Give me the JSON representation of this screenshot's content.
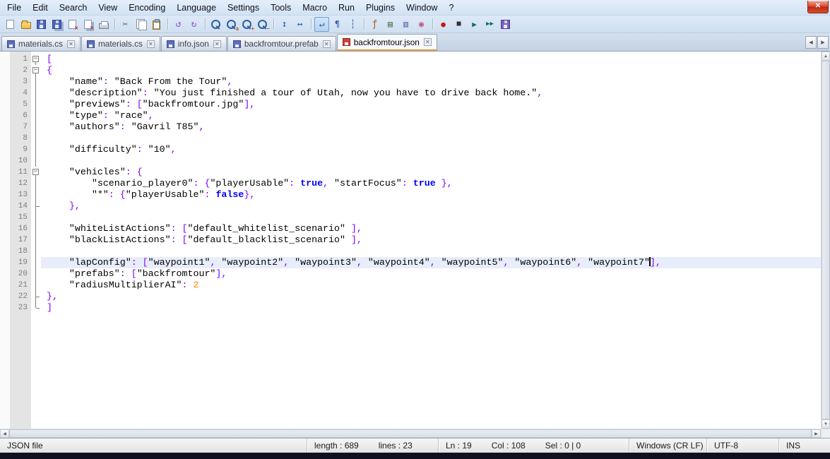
{
  "window": {
    "close_glyph": "✕"
  },
  "menubar": {
    "items": [
      {
        "label": "File"
      },
      {
        "label": "Edit"
      },
      {
        "label": "Search"
      },
      {
        "label": "View"
      },
      {
        "label": "Encoding"
      },
      {
        "label": "Language"
      },
      {
        "label": "Settings"
      },
      {
        "label": "Tools"
      },
      {
        "label": "Macro"
      },
      {
        "label": "Run"
      },
      {
        "label": "Plugins"
      },
      {
        "label": "Window"
      },
      {
        "label": "?"
      }
    ]
  },
  "toolbar": {
    "items": [
      {
        "name": "new-file",
        "kind": "css",
        "cls": "ic-page"
      },
      {
        "name": "open-file",
        "kind": "css",
        "cls": "ic-folder"
      },
      {
        "name": "save-file",
        "kind": "css",
        "cls": "ic-floppy"
      },
      {
        "name": "save-all",
        "kind": "css",
        "cls": "ic-floppy ic-multi"
      },
      {
        "name": "close-file",
        "kind": "css",
        "cls": "ic-page ic-close"
      },
      {
        "name": "close-all-files",
        "kind": "css",
        "cls": "ic-page ic-close ic-multi"
      },
      {
        "name": "print",
        "kind": "css",
        "cls": "ic-printer"
      },
      {
        "sep": true
      },
      {
        "name": "cut",
        "kind": "glyph",
        "glyph": "✂",
        "color": "#555555",
        "size": 12
      },
      {
        "name": "copy",
        "kind": "css",
        "cls": "ic-copy"
      },
      {
        "name": "paste",
        "kind": "css",
        "cls": "ic-paste"
      },
      {
        "sep": true
      },
      {
        "name": "undo",
        "kind": "glyph",
        "glyph": "↺",
        "color": "#8a4fd1",
        "size": 13
      },
      {
        "name": "redo",
        "kind": "glyph",
        "glyph": "↻",
        "color": "#8a4fd1",
        "size": 13
      },
      {
        "sep": true
      },
      {
        "name": "find",
        "kind": "css",
        "cls": "ic-mag"
      },
      {
        "name": "replace",
        "kind": "css",
        "cls": "ic-mag",
        "sub": "a"
      },
      {
        "name": "zoom-in",
        "kind": "css",
        "cls": "ic-mag",
        "sub": "+"
      },
      {
        "name": "zoom-out",
        "kind": "css",
        "cls": "ic-mag",
        "sub": "−"
      },
      {
        "sep": true
      },
      {
        "name": "sync-vertical-scrolling",
        "kind": "glyph",
        "glyph": "↕",
        "color": "#2f5fa8",
        "size": 13
      },
      {
        "name": "sync-horizontal-scrolling",
        "kind": "glyph",
        "glyph": "↔",
        "color": "#2f5fa8",
        "size": 13
      },
      {
        "sep": true
      },
      {
        "name": "word-wrap",
        "kind": "glyph",
        "glyph": "↵",
        "color": "#2f5fa8",
        "size": 13,
        "pressed": true
      },
      {
        "name": "show-all-characters",
        "kind": "glyph",
        "glyph": "¶",
        "color": "#2f5fa8",
        "size": 12
      },
      {
        "name": "show-indent-guide",
        "kind": "glyph",
        "glyph": "┆",
        "color": "#2f5fa8",
        "size": 12
      },
      {
        "sep": true
      },
      {
        "name": "function-list",
        "kind": "glyph",
        "glyph": "ƒ",
        "color": "#b05c10",
        "size": 13
      },
      {
        "name": "document-map",
        "kind": "glyph",
        "glyph": "▤",
        "color": "#4f7a4f",
        "size": 12
      },
      {
        "name": "document-list",
        "kind": "glyph",
        "glyph": "▥",
        "color": "#6a5fae",
        "size": 12
      },
      {
        "name": "monitoring",
        "kind": "glyph",
        "glyph": "◉",
        "color": "#c2527a",
        "size": 12
      },
      {
        "sep": true
      },
      {
        "name": "macro-record",
        "kind": "glyph",
        "glyph": "●",
        "color": "#cc1414",
        "size": 11
      },
      {
        "name": "macro-stop",
        "kind": "glyph",
        "glyph": "■",
        "color": "#333333",
        "size": 10
      },
      {
        "name": "macro-play",
        "kind": "glyph",
        "glyph": "▶",
        "color": "#156868",
        "size": 11
      },
      {
        "name": "macro-run-multiple",
        "kind": "glyph",
        "glyph": "▶▶",
        "color": "#156868",
        "size": 9
      },
      {
        "name": "macro-save",
        "kind": "css",
        "cls": "ic-floppy ic-purple"
      }
    ]
  },
  "tabbar": {
    "close_glyph": "✕",
    "scroll_left": "◀",
    "scroll_right": "▶",
    "tabs": [
      {
        "label": "materials.cs",
        "state": "saved",
        "active": false
      },
      {
        "label": "materials.cs",
        "state": "saved",
        "active": false
      },
      {
        "label": "info.json",
        "state": "saved",
        "active": false
      },
      {
        "label": "backfromtour.prefab",
        "state": "saved",
        "active": false
      },
      {
        "label": "backfromtour.json",
        "state": "modified",
        "active": true
      }
    ]
  },
  "editor": {
    "fold_collapse_glyph": "−",
    "current_line": 19,
    "lines": [
      {
        "n": 1,
        "fold": "box",
        "tokens": [
          [
            "p",
            "["
          ]
        ]
      },
      {
        "n": 2,
        "fold": "box",
        "tokens": [
          [
            "p",
            "{"
          ]
        ]
      },
      {
        "n": 3,
        "fold": "v",
        "tokens": [
          [
            "w",
            "    "
          ],
          [
            "s",
            "\"name\""
          ],
          [
            "p",
            ":"
          ],
          [
            "w",
            " "
          ],
          [
            "s",
            "\"Back From the Tour\""
          ],
          [
            "p",
            ","
          ]
        ]
      },
      {
        "n": 4,
        "fold": "v",
        "tokens": [
          [
            "w",
            "    "
          ],
          [
            "s",
            "\"description\""
          ],
          [
            "p",
            ":"
          ],
          [
            "w",
            " "
          ],
          [
            "s",
            "\"You just finished a tour of Utah, now you have to drive back home.\""
          ],
          [
            "p",
            ","
          ]
        ]
      },
      {
        "n": 5,
        "fold": "v",
        "tokens": [
          [
            "w",
            "    "
          ],
          [
            "s",
            "\"previews\""
          ],
          [
            "p",
            ":"
          ],
          [
            "w",
            " "
          ],
          [
            "p",
            "["
          ],
          [
            "s",
            "\"backfromtour.jpg\""
          ],
          [
            "p",
            "],"
          ]
        ]
      },
      {
        "n": 6,
        "fold": "v",
        "tokens": [
          [
            "w",
            "    "
          ],
          [
            "s",
            "\"type\""
          ],
          [
            "p",
            ":"
          ],
          [
            "w",
            " "
          ],
          [
            "s",
            "\"race\""
          ],
          [
            "p",
            ","
          ]
        ]
      },
      {
        "n": 7,
        "fold": "v",
        "tokens": [
          [
            "w",
            "    "
          ],
          [
            "s",
            "\"authors\""
          ],
          [
            "p",
            ":"
          ],
          [
            "w",
            " "
          ],
          [
            "s",
            "\"Gavril T85\""
          ],
          [
            "p",
            ","
          ]
        ]
      },
      {
        "n": 8,
        "fold": "v",
        "tokens": []
      },
      {
        "n": 9,
        "fold": "v",
        "tokens": [
          [
            "w",
            "    "
          ],
          [
            "s",
            "\"difficulty\""
          ],
          [
            "p",
            ":"
          ],
          [
            "w",
            " "
          ],
          [
            "s",
            "\"10\""
          ],
          [
            "p",
            ","
          ]
        ]
      },
      {
        "n": 10,
        "fold": "v",
        "tokens": []
      },
      {
        "n": 11,
        "fold": "box",
        "tokens": [
          [
            "w",
            "    "
          ],
          [
            "s",
            "\"vehicles\""
          ],
          [
            "p",
            ":"
          ],
          [
            "w",
            " "
          ],
          [
            "p",
            "{"
          ]
        ]
      },
      {
        "n": 12,
        "fold": "v",
        "tokens": [
          [
            "w",
            "        "
          ],
          [
            "s",
            "\"scenario_player0\""
          ],
          [
            "p",
            ":"
          ],
          [
            "w",
            " "
          ],
          [
            "p",
            "{"
          ],
          [
            "s",
            "\"playerUsable\""
          ],
          [
            "p",
            ":"
          ],
          [
            "w",
            " "
          ],
          [
            "k",
            "true"
          ],
          [
            "p",
            ","
          ],
          [
            "w",
            " "
          ],
          [
            "s",
            "\"startFocus\""
          ],
          [
            "p",
            ":"
          ],
          [
            "w",
            " "
          ],
          [
            "k",
            "true"
          ],
          [
            "w",
            " "
          ],
          [
            "p",
            "},"
          ]
        ]
      },
      {
        "n": 13,
        "fold": "v",
        "tokens": [
          [
            "w",
            "        "
          ],
          [
            "s",
            "\"*\""
          ],
          [
            "p",
            ":"
          ],
          [
            "w",
            " "
          ],
          [
            "p",
            "{"
          ],
          [
            "s",
            "\"playerUsable\""
          ],
          [
            "p",
            ":"
          ],
          [
            "w",
            " "
          ],
          [
            "k",
            "false"
          ],
          [
            "p",
            "},"
          ]
        ]
      },
      {
        "n": 14,
        "fold": "tee",
        "tokens": [
          [
            "w",
            "    "
          ],
          [
            "p",
            "},"
          ]
        ]
      },
      {
        "n": 15,
        "fold": "v",
        "tokens": []
      },
      {
        "n": 16,
        "fold": "v",
        "tokens": [
          [
            "w",
            "    "
          ],
          [
            "s",
            "\"whiteListActions\""
          ],
          [
            "p",
            ":"
          ],
          [
            "w",
            " "
          ],
          [
            "p",
            "["
          ],
          [
            "s",
            "\"default_whitelist_scenario\""
          ],
          [
            "w",
            " "
          ],
          [
            "p",
            "],"
          ]
        ]
      },
      {
        "n": 17,
        "fold": "v",
        "tokens": [
          [
            "w",
            "    "
          ],
          [
            "s",
            "\"blackListActions\""
          ],
          [
            "p",
            ":"
          ],
          [
            "w",
            " "
          ],
          [
            "p",
            "["
          ],
          [
            "s",
            "\"default_blacklist_scenario\""
          ],
          [
            "w",
            " "
          ],
          [
            "p",
            "],"
          ]
        ]
      },
      {
        "n": 18,
        "fold": "v",
        "tokens": []
      },
      {
        "n": 19,
        "fold": "v",
        "current": true,
        "tokens": [
          [
            "w",
            "    "
          ],
          [
            "s",
            "\"lapConfig\""
          ],
          [
            "p",
            ":"
          ],
          [
            "w",
            " "
          ],
          [
            "p",
            "["
          ],
          [
            "s",
            "\"waypoint1\""
          ],
          [
            "p",
            ","
          ],
          [
            "w",
            " "
          ],
          [
            "s",
            "\"waypoint2\""
          ],
          [
            "p",
            ","
          ],
          [
            "w",
            " "
          ],
          [
            "s",
            "\"waypoint3\""
          ],
          [
            "p",
            ","
          ],
          [
            "w",
            " "
          ],
          [
            "s",
            "\"waypoint4\""
          ],
          [
            "p",
            ","
          ],
          [
            "w",
            " "
          ],
          [
            "s",
            "\"waypoint5\""
          ],
          [
            "p",
            ","
          ],
          [
            "w",
            " "
          ],
          [
            "s",
            "\"waypoint6\""
          ],
          [
            "p",
            ","
          ],
          [
            "w",
            " "
          ],
          [
            "s",
            "\"waypoint7\""
          ],
          [
            "c",
            ""
          ],
          [
            "p",
            "],"
          ]
        ]
      },
      {
        "n": 20,
        "fold": "v",
        "tokens": [
          [
            "w",
            "    "
          ],
          [
            "s",
            "\"prefabs\""
          ],
          [
            "p",
            ":"
          ],
          [
            "w",
            " "
          ],
          [
            "p",
            "["
          ],
          [
            "s",
            "\"backfromtour\""
          ],
          [
            "p",
            "],"
          ]
        ]
      },
      {
        "n": 21,
        "fold": "v",
        "tokens": [
          [
            "w",
            "    "
          ],
          [
            "s",
            "\"radiusMultiplierAI\""
          ],
          [
            "p",
            ":"
          ],
          [
            "w",
            " "
          ],
          [
            "n",
            "2"
          ]
        ]
      },
      {
        "n": 22,
        "fold": "tee",
        "tokens": [
          [
            "p",
            "},"
          ]
        ]
      },
      {
        "n": 23,
        "fold": "end",
        "tokens": [
          [
            "p",
            "]"
          ]
        ]
      }
    ]
  },
  "scrollbars": {
    "up_glyph": "▲",
    "down_glyph": "▼",
    "left_glyph": "◀",
    "right_glyph": "▶"
  },
  "statusbar": {
    "doc_type": "JSON file",
    "length_label": "length : 689",
    "lines_label": "lines : 23",
    "line_label": "Ln : 19",
    "col_label": "Col : 108",
    "sel_label": "Sel : 0 | 0",
    "eol": "Windows (CR LF)",
    "encoding": "UTF-8",
    "insert_mode": "INS"
  }
}
